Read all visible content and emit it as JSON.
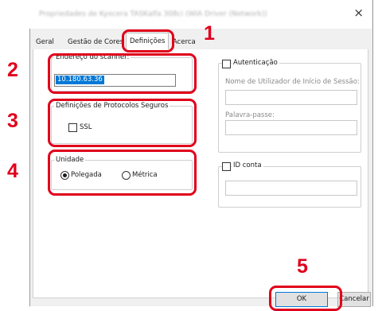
{
  "window": {
    "title": "Propriedades de Kyocera TASKalfa 308ci (WIA Driver (Network))",
    "close_glyph": "×"
  },
  "tabs": [
    {
      "label": "Geral",
      "active": false
    },
    {
      "label": "Gestão de Cores",
      "active": false
    },
    {
      "label": "Definições",
      "active": true
    },
    {
      "label": "Acerca",
      "active": false
    }
  ],
  "scanner_address": {
    "label": "Endereço do scanner:",
    "value": "10.180.63.36"
  },
  "secure_protocols": {
    "label": "Definições de Protocolos Seguros",
    "ssl_label": "SSL",
    "ssl_checked": false
  },
  "unit": {
    "label": "Unidade",
    "options": [
      {
        "label": "Polegada",
        "selected": true
      },
      {
        "label": "Métrica",
        "selected": false
      }
    ]
  },
  "authentication": {
    "label": "Autenticação",
    "checked": false,
    "username_label": "Nome de Utilizador de Início de Sessão:",
    "username_value": "",
    "password_label": "Palavra-passe:",
    "password_value": ""
  },
  "id_account": {
    "label": "ID conta",
    "checked": false,
    "value": ""
  },
  "buttons": {
    "ok": "OK",
    "cancel": "Cancelar"
  },
  "callouts": {
    "one": "1",
    "two": "2",
    "three": "3",
    "four": "4",
    "five": "5"
  },
  "colors": {
    "callout": "#e0001b",
    "selection": "#0078d7"
  }
}
